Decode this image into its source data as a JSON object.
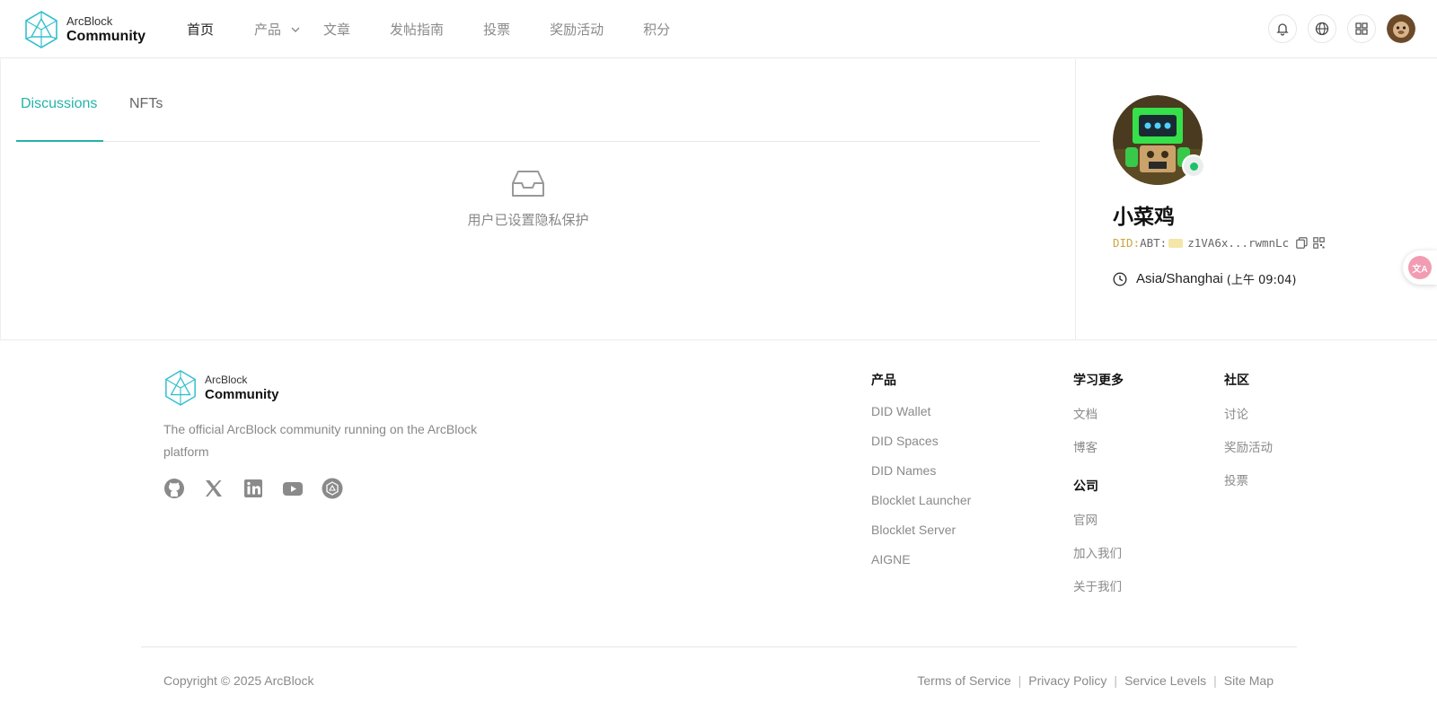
{
  "brand": {
    "top": "ArcBlock",
    "bottom": "Community",
    "accent": "#25b3a8"
  },
  "nav": {
    "items": [
      {
        "label": "首页",
        "active": true
      },
      {
        "label": "产品",
        "has_dropdown": true
      },
      {
        "label": "文章"
      },
      {
        "label": "发帖指南"
      },
      {
        "label": "投票"
      },
      {
        "label": "奖励活动"
      },
      {
        "label": "积分"
      }
    ],
    "icons": [
      "bell-icon",
      "globe-icon",
      "apps-grid-icon",
      "user-avatar"
    ]
  },
  "tabs": [
    {
      "label": "Discussions",
      "active": true
    },
    {
      "label": "NFTs"
    }
  ],
  "empty_state": {
    "icon": "inbox-icon",
    "text": "用户已设置隐私保护"
  },
  "profile": {
    "name": "小菜鸡",
    "did_prefix": "DID:",
    "did_abt": "ABT:",
    "did_value": "z1VA6x...rwmnLc",
    "timezone": "Asia/Shanghai",
    "local_time": "(上午 09:04)",
    "online": true
  },
  "footer": {
    "brand": {
      "top": "ArcBlock",
      "bottom": "Community"
    },
    "description": "The official ArcBlock community running on the ArcBlock platform",
    "socials": [
      "github-icon",
      "x-icon",
      "linkedin-icon",
      "youtube-icon",
      "arcblock-icon"
    ],
    "columns": {
      "products": {
        "title": "产品",
        "links": [
          "DID Wallet",
          "DID Spaces",
          "DID Names",
          "Blocklet Launcher",
          "Blocklet Server",
          "AIGNE"
        ]
      },
      "learn": {
        "title": "学习更多",
        "links": [
          "文档",
          "博客"
        ]
      },
      "company": {
        "title": "公司",
        "links": [
          "官网",
          "加入我们",
          "关于我们"
        ]
      },
      "community": {
        "title": "社区",
        "links": [
          "讨论",
          "奖励活动",
          "投票"
        ]
      }
    },
    "copyright": "Copyright © 2025 ArcBlock",
    "legal": [
      "Terms of Service",
      "Privacy Policy",
      "Service Levels",
      "Site Map"
    ]
  }
}
